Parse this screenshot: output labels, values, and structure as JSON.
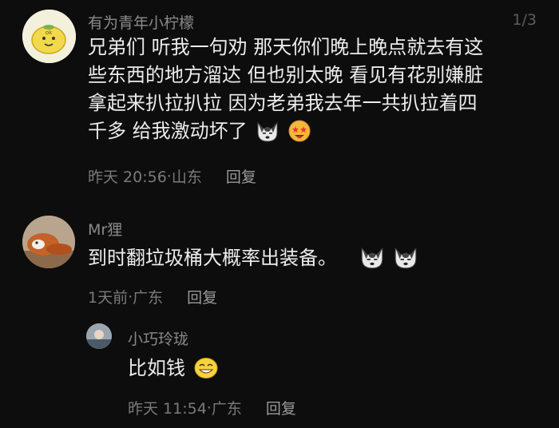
{
  "page_counter": "1/3",
  "comments": [
    {
      "username": "有为青年小柠檬",
      "lines": [
        "兄弟们 听我一句劝 那天你们晚上晚点就去有这",
        "些东西的地方溜达 但也别太晚 看见有花别嫌脏",
        "拿起来扒拉扒拉 因为老弟我去年一共扒拉着四",
        "千多 给我激动坏了"
      ],
      "emojis": [
        "husky-face-icon",
        "star-eyes-face-icon"
      ],
      "time": "昨天 20:56",
      "location": "山东",
      "reply_label": "回复"
    },
    {
      "username": "Mr狸",
      "lines": [
        "到时翻垃圾桶大概率出装备。"
      ],
      "emojis": [
        "husky-face-icon",
        "husky-face-icon"
      ],
      "time": "1天前",
      "location": "广东",
      "reply_label": "回复"
    },
    {
      "username": "小巧玲珑",
      "lines": [
        "比如钱"
      ],
      "emojis": [
        "grin-face-icon"
      ],
      "time": "昨天 11:54",
      "location": "广东",
      "reply_label": "回复"
    }
  ],
  "colors": {
    "background": "#0d0d0d",
    "username": "#8a8a8a",
    "body": "#ececec",
    "meta": "#7a7a7a"
  }
}
